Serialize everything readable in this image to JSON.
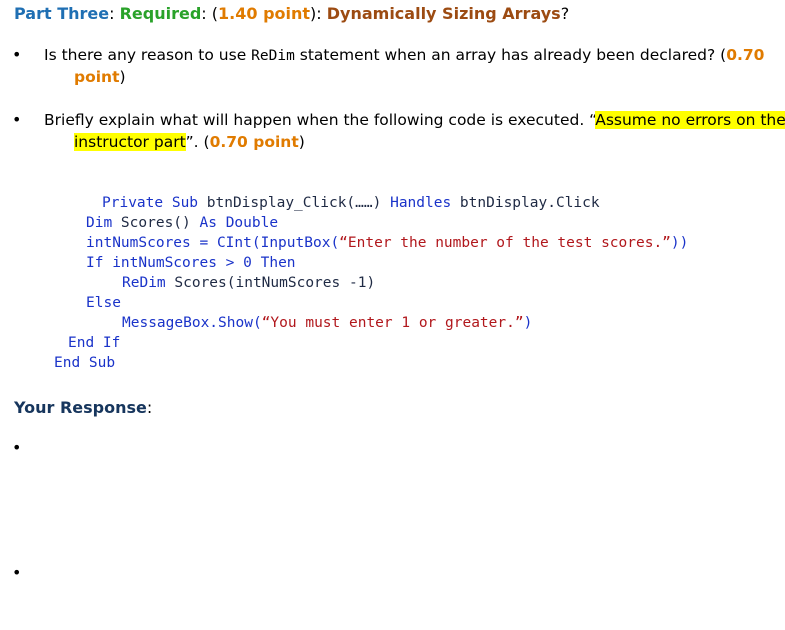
{
  "heading": {
    "part": "Part Three",
    "colon1": ": ",
    "required": "Required",
    "colon2": ": (",
    "points": "1.40 point",
    "close": "): ",
    "topic": "Dynamically Sizing Arrays",
    "qmark": "?"
  },
  "questions": [
    {
      "bullet": "•",
      "line1_text": "Is there any reason to use ",
      "redim": "ReDim",
      "line1_text2": " statement when an array has already been declared? (",
      "points1": "0.70",
      "points2": "point",
      "close": ")"
    },
    {
      "bullet": "•",
      "line1_text": "Briefly explain what will happen when the following code is executed. “",
      "hl1": "Assume no errors on the",
      "hl2": "instructor part",
      "after_hl": "”. (",
      "points": "0.70 point",
      "close": ")"
    }
  ],
  "code": {
    "l1": {
      "kw1": "Private Sub",
      "t1": " btnDisplay_Click(……) ",
      "kw2": "Handles",
      "t2": " btnDisplay.Click"
    },
    "l2": {
      "kw1": "Dim",
      "t1": " Scores() ",
      "kw2": "As Double"
    },
    "l3": {
      "t1": "intNumScores = ",
      "kw1": "CInt(InputBox(",
      "str": "“Enter the number of the test scores.”",
      "kw2": "))"
    },
    "l4": {
      "kw1": "If",
      "t1": " intNumScores > 0 ",
      "kw2": "Then"
    },
    "l5": {
      "kw1": "ReDim",
      "t1": " Scores(intNumScores -1)"
    },
    "l6": {
      "kw1": "Else"
    },
    "l7": {
      "kw1": "MessageBox.Show(",
      "str": "“You must enter 1 or greater.”",
      "kw2": ")"
    },
    "l8": {
      "kw1": "End If"
    },
    "l9": {
      "kw1": "End Sub"
    }
  },
  "response": {
    "label": "Your Response",
    "colon": ":",
    "bullets": [
      "•",
      "•"
    ]
  }
}
